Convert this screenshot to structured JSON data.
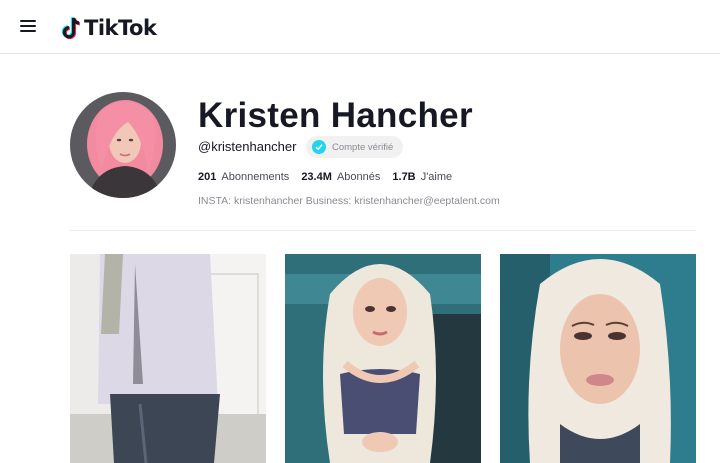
{
  "header": {
    "logo_text": "TikTok",
    "icons": {
      "menu": "hamburger-menu-icon",
      "logo": "tiktok-note-icon"
    }
  },
  "profile": {
    "name": "Kristen Hancher",
    "handle": "@kristenhancher",
    "verified_label": "Compte vérifié",
    "stats": {
      "following_count": "201",
      "following_label": "Abonnements",
      "followers_count": "23.4M",
      "followers_label": "Abonnés",
      "likes_count": "1.7B",
      "likes_label": "J'aime"
    },
    "bio": "INSTA: kristenhancher Business: kristenhancher@eeptalent.com"
  },
  "videos": [
    {
      "id": "video-1"
    },
    {
      "id": "video-2"
    },
    {
      "id": "video-3"
    }
  ],
  "colors": {
    "text_primary": "#161823",
    "text_secondary": "#8a8b91",
    "verified_badge": "#20d5ec",
    "logo_cyan": "#25f4ee",
    "logo_red": "#fe2c55",
    "divider": "#ebebec"
  }
}
